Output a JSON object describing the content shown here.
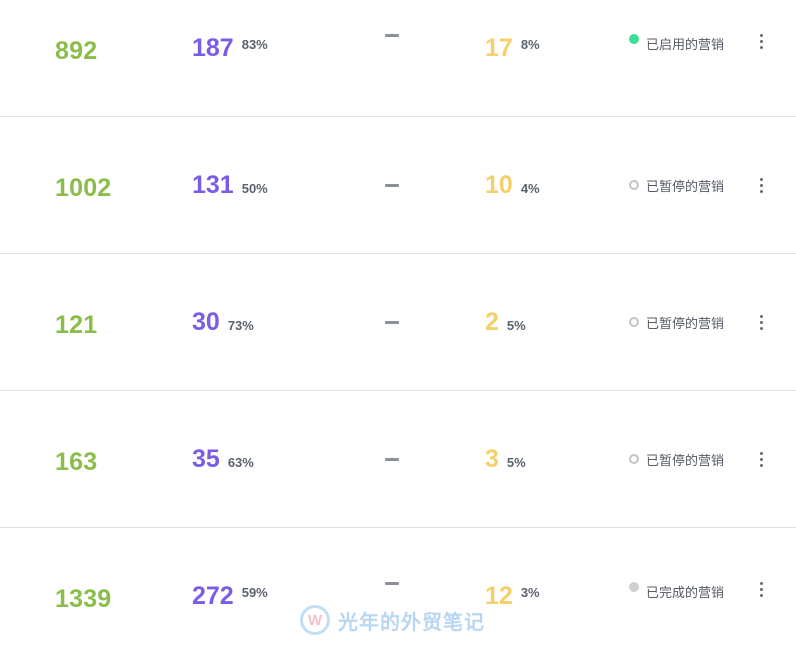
{
  "rows": [
    {
      "sent": "892",
      "opens": "187",
      "open_rate": "83%",
      "clicks": "—",
      "unsubs": "17",
      "unsub_rate": "8%",
      "status": "已启用的营销",
      "status_type": "active"
    },
    {
      "sent": "1002",
      "opens": "131",
      "open_rate": "50%",
      "clicks": "—",
      "unsubs": "10",
      "unsub_rate": "4%",
      "status": "已暂停的营销",
      "status_type": "paused"
    },
    {
      "sent": "121",
      "opens": "30",
      "open_rate": "73%",
      "clicks": "—",
      "unsubs": "2",
      "unsub_rate": "5%",
      "status": "已暂停的营销",
      "status_type": "paused"
    },
    {
      "sent": "163",
      "opens": "35",
      "open_rate": "63%",
      "clicks": "—",
      "unsubs": "3",
      "unsub_rate": "5%",
      "status": "已暂停的营销",
      "status_type": "paused"
    },
    {
      "sent": "1339",
      "opens": "272",
      "open_rate": "59%",
      "clicks": "—",
      "unsubs": "12",
      "unsub_rate": "3%",
      "status": "已完成的营销",
      "status_type": "completed"
    }
  ],
  "watermark": {
    "logo_letter": "W",
    "text": "光年的外贸笔记"
  },
  "icons": {
    "row_menu": "more-vertical-icon",
    "status": "status-dot-icon"
  },
  "colors": {
    "sent": "#8bbd4a",
    "opens": "#7b5ce6",
    "unsubs": "#f5cf6a",
    "status_active": "#3ddc97",
    "status_paused": "#c4c4c4",
    "status_completed": "#cfcfcf"
  }
}
